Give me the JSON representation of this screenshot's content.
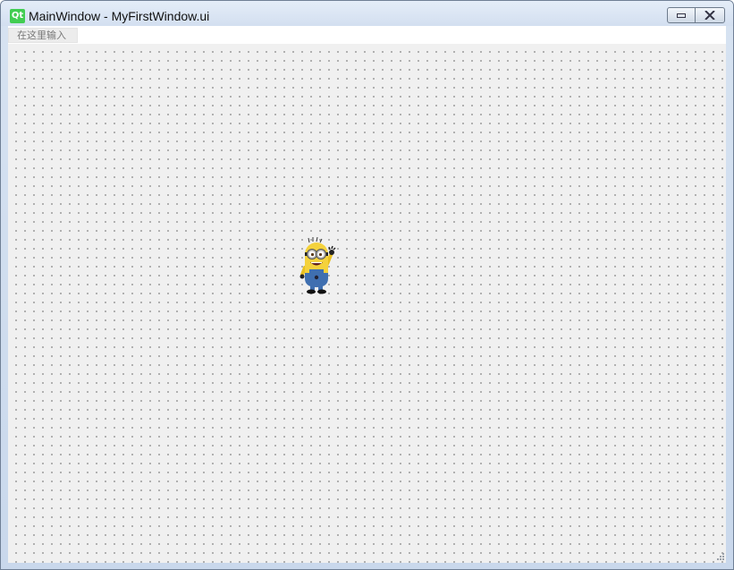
{
  "window": {
    "title": "MainWindow - MyFirstWindow.ui",
    "logo_text": "Qt",
    "minimize_label": "minimize",
    "close_label": "close"
  },
  "menubar": {
    "input_placeholder": "在这里输入"
  },
  "canvas": {
    "image_name": "minion-image",
    "background_color": "#f0f0f0"
  },
  "icons": {
    "logo": "qt-logo-icon",
    "minimize": "minimize-icon",
    "close": "close-icon",
    "grip": "size-grip-icon"
  }
}
